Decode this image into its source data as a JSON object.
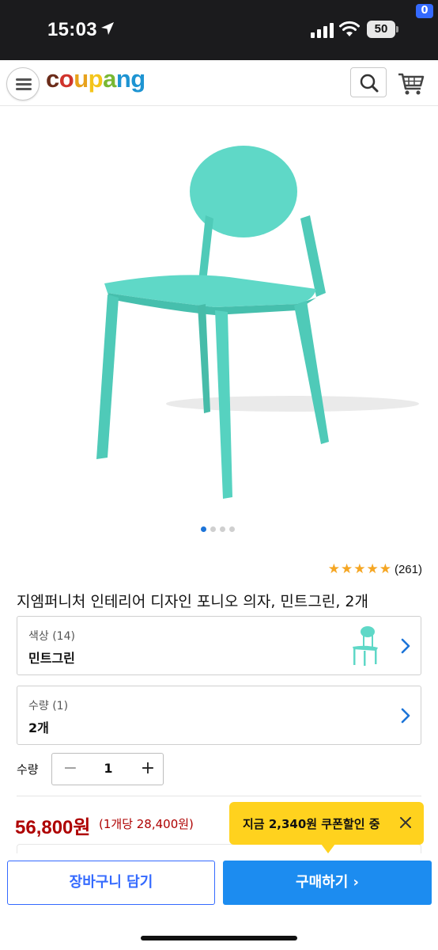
{
  "status_bar": {
    "time": "15:03",
    "battery": "50"
  },
  "header": {
    "logo_letters": [
      "c",
      "o",
      "u",
      "p",
      "a",
      "n",
      "g"
    ],
    "logo_colors": [
      "#6b2c1a",
      "#d0342c",
      "#e7a21c",
      "#f4c51b",
      "#79b833",
      "#1e94d2",
      "#1e94d2"
    ],
    "cart_count": "0",
    "accent_color": "#346aff"
  },
  "product": {
    "image_color": "#5fd8c7",
    "gallery_pages": 4,
    "gallery_active": 0,
    "rating_stars": 5,
    "rating_count": "(261)",
    "title": "지엠퍼니처 인테리어 디자인 포니오 의자, 민트그린, 2개"
  },
  "options": [
    {
      "label": "색상 (14)",
      "value": "민트그린"
    },
    {
      "label": "수량 (1)",
      "value": "2개"
    }
  ],
  "quantity": {
    "label": "수량",
    "minus": "−",
    "value": "1",
    "plus": "+"
  },
  "price": {
    "total": "56,800원",
    "unit": "(1개당 28,400원)",
    "color": "#ae0000"
  },
  "coupon": {
    "text": "지금 2,340원 쿠폰할인 중",
    "bg_color": "#ffd21e"
  },
  "actions": {
    "cart_label": "장바구니 담기",
    "buy_label": "구매하기 ›",
    "buy_color": "#1c8cf0"
  }
}
